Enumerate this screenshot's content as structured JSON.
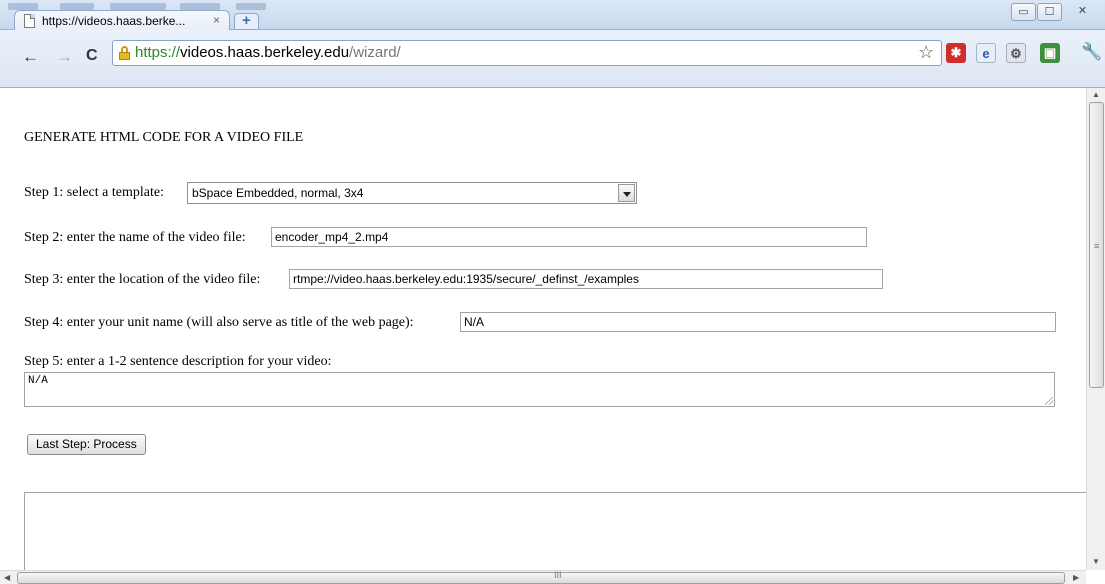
{
  "browser": {
    "tab_title": "https://videos.haas.berke...",
    "tab_close": "×",
    "url_scheme": "https://",
    "url_host": "videos.haas.berkeley.edu",
    "url_path": "/wizard/",
    "window_minimize": "▭",
    "window_maximize": "☐",
    "window_close": "✕",
    "nav_back": "←",
    "nav_forward": "→",
    "nav_reload": "C",
    "star": "☆",
    "wrench": "🔧"
  },
  "page": {
    "heading": "GENERATE HTML CODE FOR A VIDEO FILE",
    "step1": {
      "label": "Step 1: select a template:",
      "selected": "bSpace Embedded, normal, 3x4"
    },
    "step2": {
      "label": "Step 2: enter the name of the video file:",
      "value": "encoder_mp4_2.mp4"
    },
    "step3": {
      "label": "Step 3: enter the location of the video file:",
      "value": "rtmpe://video.haas.berkeley.edu:1935/secure/_definst_/examples"
    },
    "step4": {
      "label": "Step 4: enter your unit name (will also serve as title of the web page):",
      "value": "N/A"
    },
    "step5": {
      "label": "Step 5: enter a 1-2 sentence description for your video:",
      "value": "N/A"
    },
    "process_button": "Last Step: Process",
    "output": ""
  },
  "scrollbars": {
    "up": "▲",
    "down": "▼",
    "left": "◀",
    "right": "▶",
    "grip_v": "≡",
    "grip_h": "III"
  },
  "colors": {
    "url_scheme": "#2b8a2b",
    "frame": "#c7d8ee"
  }
}
